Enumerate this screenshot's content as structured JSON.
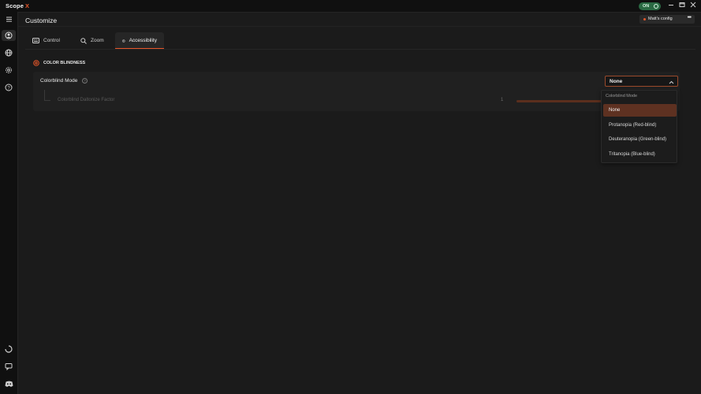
{
  "app": {
    "name": "Scope",
    "name_accent": "X",
    "accent_color": "#e8572a"
  },
  "titlebar": {
    "toggle_label": "ON",
    "minimize_icon": "minimize-icon",
    "maximize_icon": "maximize-icon",
    "close_icon": "close-icon"
  },
  "rail": {
    "items": [
      {
        "icon": "menu-icon"
      },
      {
        "icon": "user-circle-icon",
        "active": true
      },
      {
        "icon": "globe-icon"
      },
      {
        "icon": "gear-icon"
      },
      {
        "icon": "help-icon"
      }
    ],
    "bottom_items": [
      {
        "icon": "loading-icon"
      },
      {
        "icon": "chat-icon"
      },
      {
        "icon": "discord-icon"
      }
    ]
  },
  "page": {
    "title": "Customize"
  },
  "config": {
    "label": "Matt's config",
    "more": "•••"
  },
  "tabs": [
    {
      "label": "Control",
      "icon": "keyboard-icon"
    },
    {
      "label": "Zoom",
      "icon": "search-icon"
    },
    {
      "label": "Accessibility",
      "icon": "accessibility-icon",
      "active": true
    }
  ],
  "section": {
    "title": "COLOR BLINDNESS",
    "icon": "eye-icon"
  },
  "settings": {
    "colorblind_mode_label": "Colorblind Mode",
    "daltonize_label": "Colorblind Daltonize Factor",
    "daltonize_value": "1",
    "daltonize_fraction": 1.0
  },
  "select": {
    "value": "None",
    "dropdown_header": "Colorblind Mode",
    "options": [
      "None",
      "Protanopia (Red-blind)",
      "Deuteranopia (Green-blind)",
      "Tritanopia (Blue-blind)"
    ],
    "selected_index": 0
  }
}
